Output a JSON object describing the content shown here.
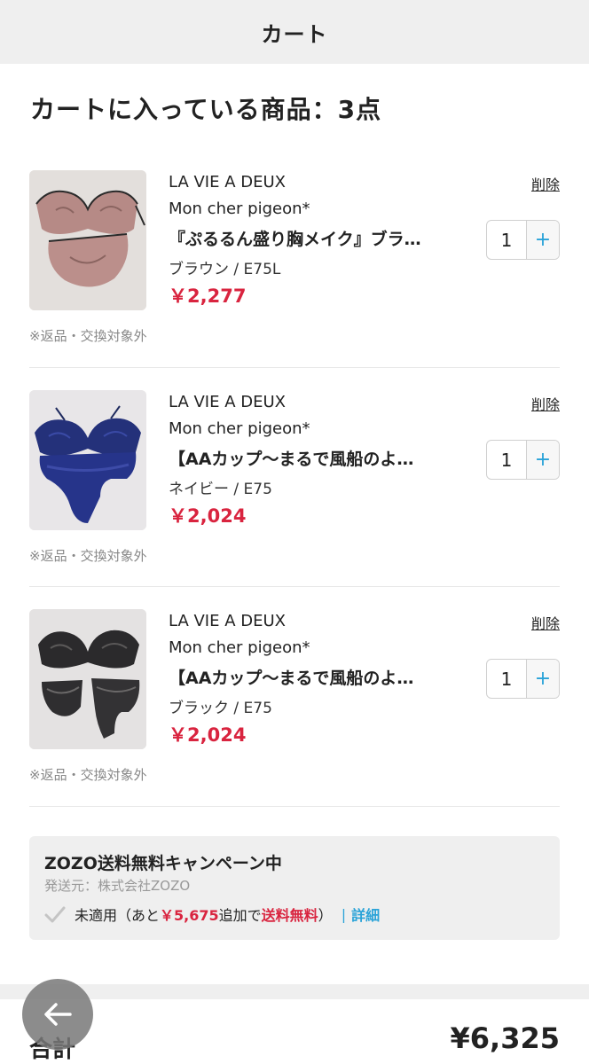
{
  "header": {
    "title": "カート"
  },
  "cart": {
    "heading": "カートに入っている商品：3点"
  },
  "items": [
    {
      "brand": "LA VIE A DEUX",
      "shop": "Mon cher pigeon*",
      "name": "『ぷるるん盛り胸メイク』ブラ…",
      "variant": "ブラウン / E75L",
      "price": "￥2,277",
      "quantity": "1",
      "plus_label": "+",
      "delete_label": "削除",
      "note": "※返品・交換対象外",
      "image_icon": "pink-lace-bra-set-photo"
    },
    {
      "brand": "LA VIE A DEUX",
      "shop": "Mon cher pigeon*",
      "name": "【AAカップ〜まるで風船のよ…",
      "variant": "ネイビー / E75",
      "price": "￥2,024",
      "quantity": "1",
      "plus_label": "+",
      "delete_label": "削除",
      "note": "※返品・交換対象外",
      "image_icon": "navy-lace-bra-set-photo"
    },
    {
      "brand": "LA VIE A DEUX",
      "shop": "Mon cher pigeon*",
      "name": "【AAカップ〜まるで風船のよ…",
      "variant": "ブラック / E75",
      "price": "￥2,024",
      "quantity": "1",
      "plus_label": "+",
      "delete_label": "削除",
      "note": "※返品・交換対象外",
      "image_icon": "black-lace-bra-set-photo"
    }
  ],
  "campaign": {
    "title": "ZOZO送料無料キャンペーン中",
    "sender": "発送元：株式会社ZOZO",
    "status_prefix": "未適用（あと",
    "remaining_amount": "￥5,675",
    "status_middle": "追加で",
    "free_shipping": "送料無料",
    "status_suffix": "）",
    "separator": "|",
    "detail_label": "詳細"
  },
  "total": {
    "label": "合計",
    "value": "¥6,325"
  },
  "colors": {
    "price_red": "#d9243f",
    "accent_blue": "#2aa3d8",
    "header_bg": "#efefef"
  },
  "icons": {
    "check": "check-icon",
    "back": "arrow-left-icon"
  }
}
